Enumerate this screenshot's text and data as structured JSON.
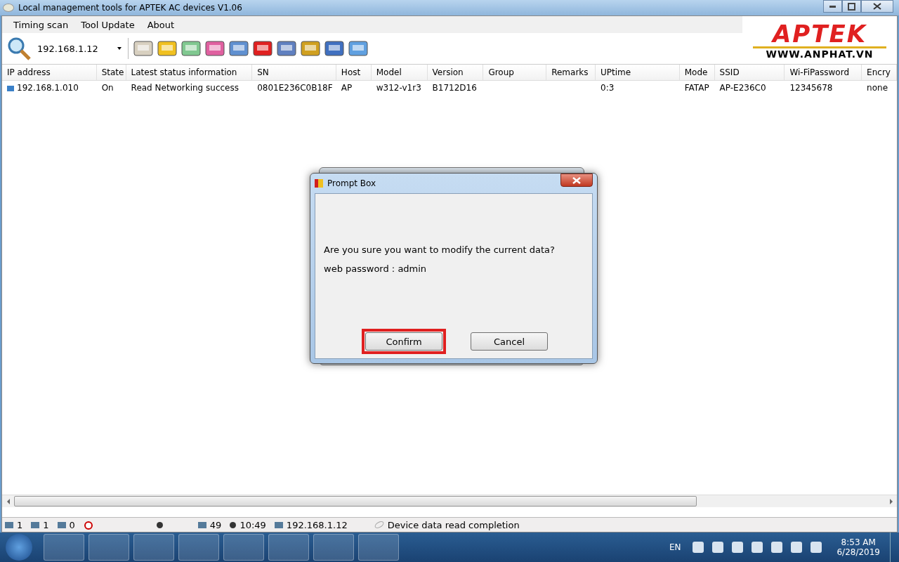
{
  "window": {
    "title": "Local management tools for APTEK AC devices  V1.06"
  },
  "menu": [
    "Timing scan",
    "Tool Update",
    "About"
  ],
  "toolbar": {
    "ip_value": "192.168.1.12"
  },
  "logo": {
    "brand": "APTEK",
    "url": "WWW.ANPHAT.VN"
  },
  "table": {
    "columns": [
      "IP address",
      "State",
      "Latest status information",
      "SN",
      "Host",
      "Model",
      "Version",
      "Group",
      "Remarks",
      "UPtime",
      "Mode",
      "SSID",
      "Wi-FiPassword",
      "Encry"
    ],
    "rows": [
      {
        "cells": [
          "192.168.1.010",
          "On",
          "Read Networking success",
          "0801E236C0B18F",
          "AP",
          "w312-v1r3",
          "B1712D16",
          "",
          "",
          "0:3",
          "FATAP",
          "AP-E236C0",
          "12345678",
          "none"
        ]
      }
    ]
  },
  "dialog": {
    "title": "Prompt Box",
    "message": "Are you sure you want to modify the current data?",
    "detail": "web password : admin",
    "buttons": [
      {
        "label": "Confirm",
        "highlighted": true
      },
      {
        "label": "Cancel",
        "highlighted": false
      }
    ]
  },
  "status_bar": [
    {
      "kind": "count",
      "text": "1"
    },
    {
      "kind": "count",
      "text": "1"
    },
    {
      "kind": "count",
      "text": "0"
    },
    {
      "kind": "alarm"
    },
    {
      "kind": "dot"
    },
    {
      "kind": "count",
      "text": "49"
    },
    {
      "kind": "time",
      "text": "10:49"
    },
    {
      "kind": "count",
      "text": "192.168.1.12"
    },
    {
      "kind": "message",
      "text": "Device data read completion"
    }
  ],
  "taskbar": {
    "language": "EN",
    "time": "8:53 AM",
    "date": "6/28/2019"
  }
}
